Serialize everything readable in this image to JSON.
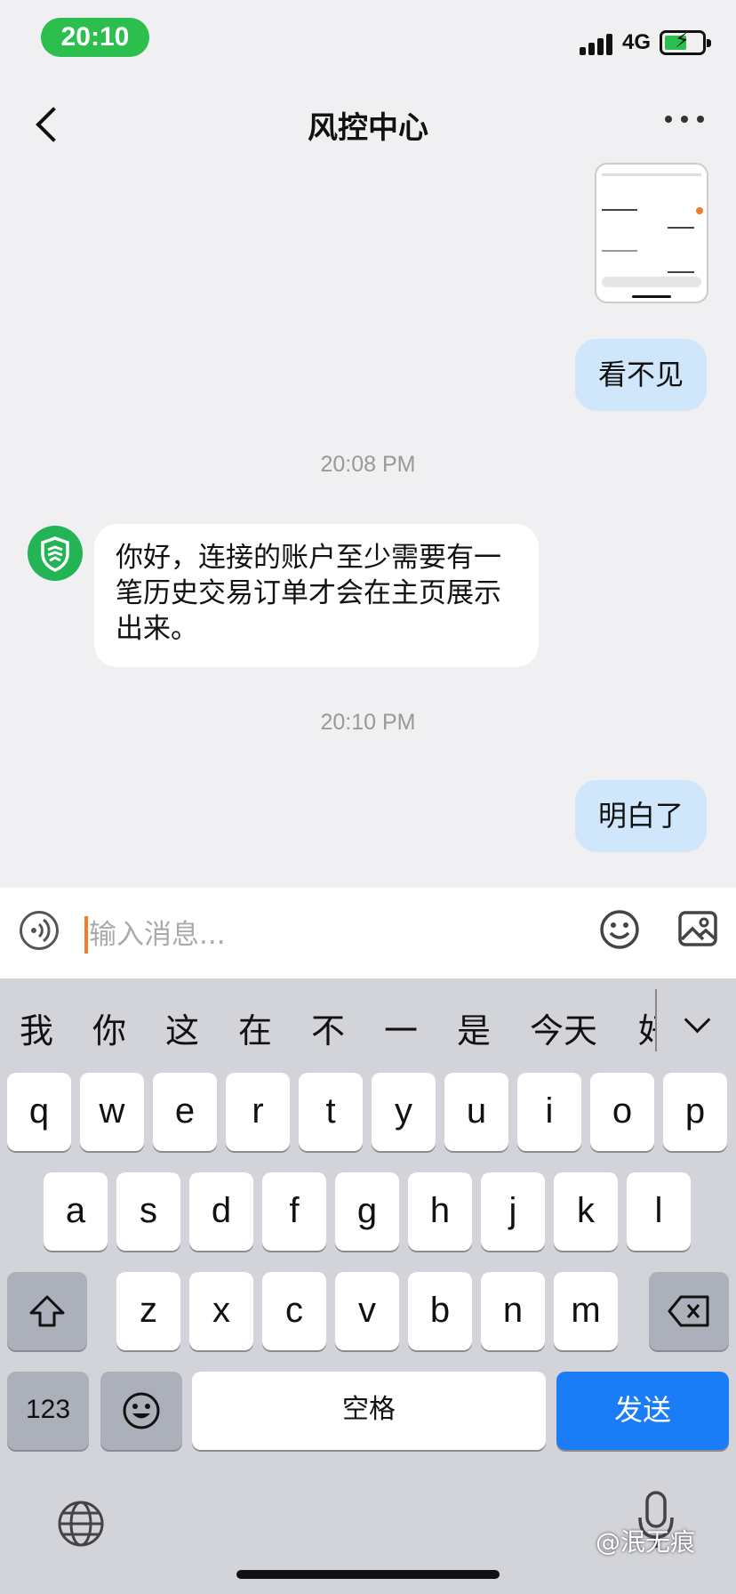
{
  "status_bar": {
    "time": "20:10",
    "network": "4G"
  },
  "header": {
    "title": "风控中心"
  },
  "messages": {
    "outgoing_1": "看不见",
    "timestamp_1": "20:08 PM",
    "incoming_1": "你好，连接的账户至少需要有一笔历史交易订单才会在主页展示出来。",
    "timestamp_2": "20:10 PM",
    "outgoing_2": "明白了"
  },
  "input": {
    "placeholder": "输入消息..."
  },
  "keyboard": {
    "candidates": [
      "我",
      "你",
      "这",
      "在",
      "不",
      "一",
      "是",
      "今天",
      "好"
    ],
    "row1": [
      "q",
      "w",
      "e",
      "r",
      "t",
      "y",
      "u",
      "i",
      "o",
      "p"
    ],
    "row2": [
      "a",
      "s",
      "d",
      "f",
      "g",
      "h",
      "j",
      "k",
      "l"
    ],
    "row3": [
      "z",
      "x",
      "c",
      "v",
      "b",
      "n",
      "m"
    ],
    "numbers_label": "123",
    "space_label": "空格",
    "send_label": "发送"
  },
  "watermark": "@泯无痕",
  "colors": {
    "accent_green": "#2dbf4e",
    "bubble_blue": "#cfe6fb",
    "send_blue": "#1a7cf6"
  }
}
